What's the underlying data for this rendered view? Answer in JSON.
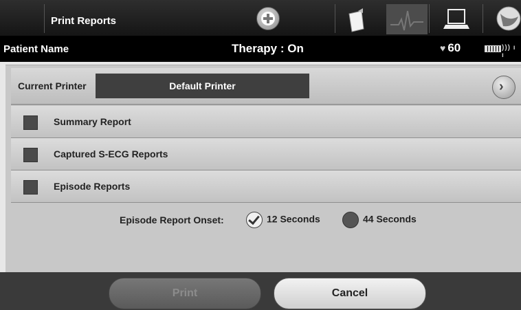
{
  "header": {
    "title": "Print Reports",
    "icons": [
      "add-icon",
      "clipboard-icon",
      "ecg-icon",
      "monitor-icon",
      "sphere-icon"
    ]
  },
  "patient_bar": {
    "patient_name": "Patient Name",
    "therapy": "Therapy : On",
    "heart_rate": "60"
  },
  "printer": {
    "label": "Current Printer",
    "value": "Default Printer"
  },
  "reports": [
    {
      "label": "Summary Report",
      "checked": false
    },
    {
      "label": "Captured S-ECG Reports",
      "checked": false
    },
    {
      "label": "Episode Reports",
      "checked": false
    }
  ],
  "onset": {
    "label": "Episode Report Onset:",
    "options": [
      {
        "label": "12 Seconds",
        "selected": true
      },
      {
        "label": "44 Seconds",
        "selected": false
      }
    ]
  },
  "footer": {
    "print_label": "Print",
    "cancel_label": "Cancel"
  }
}
